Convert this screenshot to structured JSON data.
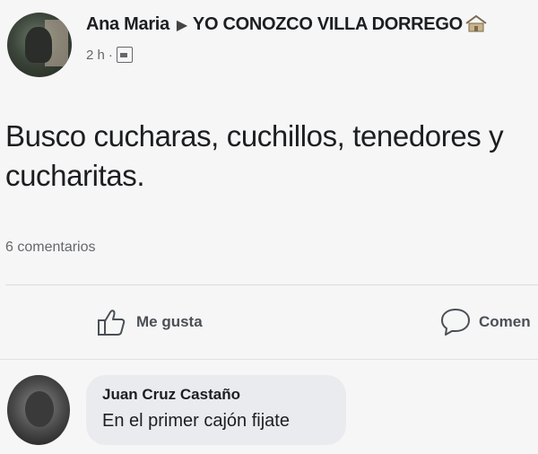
{
  "post": {
    "author": "Ana Maria",
    "group": "YO CONOZCO VILLA DORREGO",
    "time": "2 h",
    "text": "Busco cucharas, cuchillos, tenedores y cucharitas.",
    "comment_count": "6 comentarios"
  },
  "actions": {
    "like_label": "Me gusta",
    "comment_label": "Comen"
  },
  "comment": {
    "author": "Juan Cruz Castaño",
    "text": "En el primer cajón fijate"
  },
  "icons": {
    "group_arrow": "arrow-right-icon",
    "group_badge": "house-icon",
    "privacy": "globe-icon",
    "like": "thumbs-up-icon",
    "comment": "comment-icon"
  }
}
